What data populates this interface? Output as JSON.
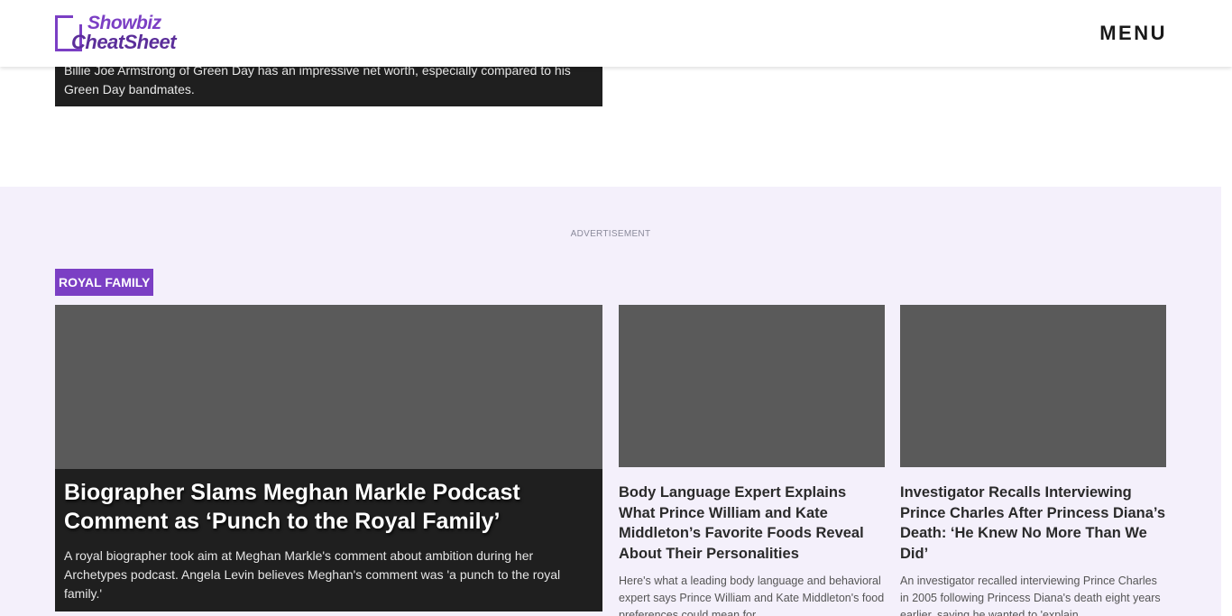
{
  "header": {
    "logo_word1": "Showbiz",
    "logo_word2": "CheatSheet",
    "menu_label": "MENU"
  },
  "previous_article": {
    "description": "Billie Joe Armstrong of Green Day has an impressive net worth, especially compared to his Green Day bandmates."
  },
  "section": {
    "advertisement_label": "ADVERTISEMENT",
    "category_tag": "ROYAL FAMILY",
    "featured": {
      "title": "Biographer Slams Meghan Markle Podcast Comment as ‘Punch to the Royal Family’",
      "description": "A royal biographer took aim at Meghan Markle's comment about ambition during her Archetypes podcast. Angela Levin believes Meghan's comment was 'a punch to the royal family.'"
    },
    "cards": [
      {
        "title": "Body Language Expert Explains What Prince William and Kate Middleton’s Favorite Foods Reveal About Their Personalities",
        "description": "Here's what a leading body language and behavioral expert says Prince William and Kate Middleton's food preferences could mean for"
      },
      {
        "title": "Investigator Recalls Interviewing Prince Charles After Princess Diana’s Death: ‘He Knew No More Than We Did’",
        "description": "An investigator recalled interviewing Prince Charles in 2005 following Princess Diana's death eight years earlier, saying he wanted to 'explain"
      }
    ]
  },
  "colors": {
    "brand_purple": "#7b3fc4",
    "section_background": "#f4f0fb",
    "image_placeholder": "#5a5a5a",
    "caption_background": "#1f1f1f"
  }
}
